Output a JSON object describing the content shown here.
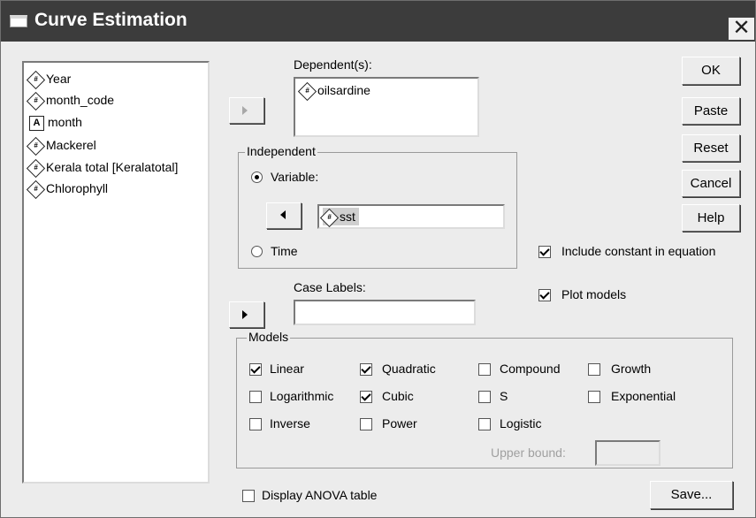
{
  "window": {
    "title": "Curve Estimation",
    "close_symbol": "✕"
  },
  "variables": [
    {
      "label": "Year",
      "icon": "numeric-variable-icon"
    },
    {
      "label": "month_code",
      "icon": "numeric-variable-icon"
    },
    {
      "label": "month",
      "icon": "string-variable-icon"
    },
    {
      "label": "Mackerel",
      "icon": "numeric-variable-icon"
    },
    {
      "label": "Kerala total [Keralatotal]",
      "icon": "numeric-variable-icon"
    },
    {
      "label": "Chlorophyll",
      "icon": "numeric-variable-icon"
    }
  ],
  "dependent": {
    "label": "Dependent(s):",
    "items": [
      "oilsardine"
    ]
  },
  "independent": {
    "group_label": "Independent",
    "variable_label": "Variable:",
    "variable_value": "sst",
    "time_label": "Time",
    "selected": "Variable"
  },
  "case_labels": {
    "label": "Case Labels:",
    "value": ""
  },
  "buttons": {
    "ok": "OK",
    "paste": "Paste",
    "reset": "Reset",
    "cancel": "Cancel",
    "help": "Help",
    "save": "Save..."
  },
  "options": {
    "include_constant": {
      "label": "Include constant in equation",
      "checked": true
    },
    "plot_models": {
      "label": "Plot models",
      "checked": true
    },
    "display_anova": {
      "label": "Display ANOVA table",
      "checked": false
    }
  },
  "models": {
    "group_label": "Models",
    "linear": {
      "label": "Linear",
      "checked": true
    },
    "quadratic": {
      "label": "Quadratic",
      "checked": true
    },
    "compound": {
      "label": "Compound",
      "checked": false
    },
    "growth": {
      "label": "Growth",
      "checked": false
    },
    "logarithmic": {
      "label": "Logarithmic",
      "checked": false
    },
    "cubic": {
      "label": "Cubic",
      "checked": true
    },
    "s": {
      "label": "S",
      "checked": false
    },
    "exponential": {
      "label": "Exponential",
      "checked": false
    },
    "inverse": {
      "label": "Inverse",
      "checked": false
    },
    "power": {
      "label": "Power",
      "checked": false
    },
    "logistic": {
      "label": "Logistic",
      "checked": false
    },
    "upper_bound": {
      "label": "Upper bound:",
      "value": ""
    }
  }
}
